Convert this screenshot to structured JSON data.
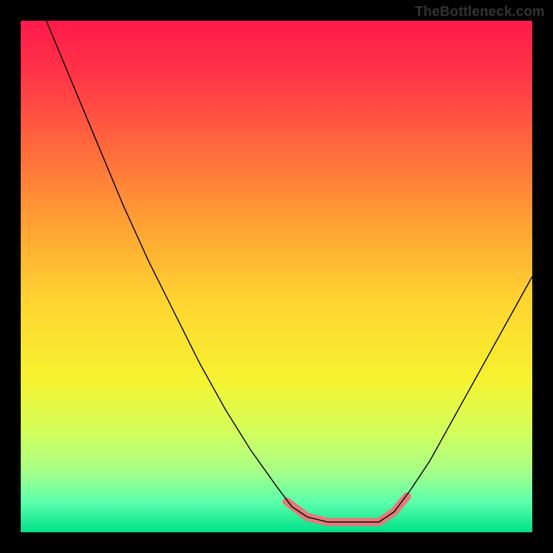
{
  "watermark": "TheBottleneck.com",
  "chart_data": {
    "type": "line",
    "title": "",
    "xlabel": "",
    "ylabel": "",
    "xlim": [
      0,
      100
    ],
    "ylim": [
      0,
      100
    ],
    "background_gradient": {
      "stops": [
        {
          "pos": 0.0,
          "color": "#ff1a4b"
        },
        {
          "pos": 0.1,
          "color": "#ff3348"
        },
        {
          "pos": 0.25,
          "color": "#ff6a3c"
        },
        {
          "pos": 0.4,
          "color": "#ffa233"
        },
        {
          "pos": 0.55,
          "color": "#ffd531"
        },
        {
          "pos": 0.7,
          "color": "#f6f230"
        },
        {
          "pos": 0.8,
          "color": "#d5ff5a"
        },
        {
          "pos": 0.88,
          "color": "#a8ff88"
        },
        {
          "pos": 0.94,
          "color": "#5dffac"
        },
        {
          "pos": 1.0,
          "color": "#00e08a"
        }
      ]
    },
    "series": [
      {
        "name": "bottleneck-curve",
        "color": "#000000",
        "width": 1.5,
        "points": [
          {
            "x": 5,
            "y": 100
          },
          {
            "x": 10,
            "y": 88
          },
          {
            "x": 15,
            "y": 76
          },
          {
            "x": 20,
            "y": 64
          },
          {
            "x": 25,
            "y": 53
          },
          {
            "x": 30,
            "y": 43
          },
          {
            "x": 35,
            "y": 33
          },
          {
            "x": 40,
            "y": 24
          },
          {
            "x": 45,
            "y": 16
          },
          {
            "x": 50,
            "y": 9
          },
          {
            "x": 53,
            "y": 5
          },
          {
            "x": 56,
            "y": 3
          },
          {
            "x": 60,
            "y": 2
          },
          {
            "x": 65,
            "y": 2
          },
          {
            "x": 70,
            "y": 2
          },
          {
            "x": 73,
            "y": 4
          },
          {
            "x": 76,
            "y": 8
          },
          {
            "x": 80,
            "y": 14
          },
          {
            "x": 85,
            "y": 23
          },
          {
            "x": 90,
            "y": 32
          },
          {
            "x": 95,
            "y": 41
          },
          {
            "x": 100,
            "y": 50
          }
        ]
      },
      {
        "name": "highlight-band",
        "color": "#e37a7c",
        "width": 12,
        "points": [
          {
            "x": 52,
            "y": 6
          },
          {
            "x": 56,
            "y": 3
          },
          {
            "x": 60,
            "y": 2
          },
          {
            "x": 65,
            "y": 2
          },
          {
            "x": 70,
            "y": 2
          },
          {
            "x": 73,
            "y": 4
          },
          {
            "x": 75.5,
            "y": 7
          }
        ]
      }
    ]
  }
}
